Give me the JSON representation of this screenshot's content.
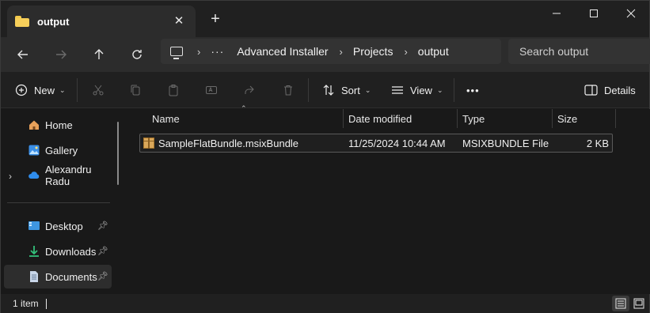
{
  "tab": {
    "title": "output",
    "close_icon": "close-icon",
    "new_tab_icon": "plus-icon"
  },
  "window_controls": {
    "minimize": "minimize-icon",
    "maximize": "maximize-icon",
    "close": "close-icon"
  },
  "breadcrumb": {
    "root_icon": "computer-icon",
    "overflow": "···",
    "items": [
      "Advanced Installer",
      "Projects",
      "output"
    ]
  },
  "search": {
    "placeholder": "Search output"
  },
  "toolbar": {
    "new_label": "New",
    "sort_label": "Sort",
    "view_label": "View",
    "more_label": "•••",
    "details_label": "Details"
  },
  "sidebar": {
    "items": [
      {
        "label": "Home",
        "icon": "home-icon"
      },
      {
        "label": "Gallery",
        "icon": "gallery-icon"
      },
      {
        "label": "Alexandru Radu",
        "icon": "onedrive-icon"
      },
      {
        "label": "Desktop",
        "icon": "desktop-icon",
        "pinned": true
      },
      {
        "label": "Downloads",
        "icon": "downloads-icon",
        "pinned": true
      },
      {
        "label": "Documents",
        "icon": "documents-icon",
        "pinned": true,
        "selected": true
      }
    ]
  },
  "columns": [
    "Name",
    "Date modified",
    "Type",
    "Size"
  ],
  "files": [
    {
      "name": "SampleFlatBundle.msixBundle",
      "date": "11/25/2024 10:44 AM",
      "type": "MSIXBUNDLE File",
      "size": "2 KB"
    }
  ],
  "status": {
    "item_count": "1 item"
  },
  "colors": {
    "accent": "#4cc2ff",
    "folder": "#f7cf5a"
  }
}
